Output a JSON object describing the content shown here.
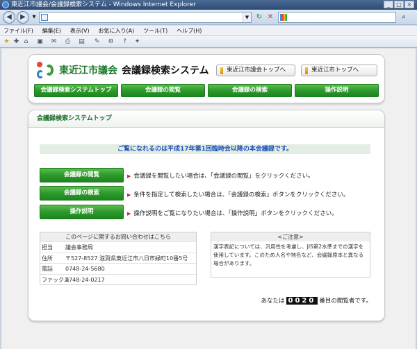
{
  "window": {
    "title": "東近江市議会/会議録検索システム - Windows Internet Explorer"
  },
  "browser": {
    "address_prefix": "e",
    "menu": [
      "ファイル(F)",
      "編集(E)",
      "表示(V)",
      "お気に入り(A)",
      "ツール(T)",
      "ヘルプ(H)"
    ]
  },
  "header": {
    "org_name": "東近江市議会",
    "system_name": "会議録検索システム",
    "link_council": "東近江市議会トップへ",
    "link_city": "東近江市トップへ",
    "tabs": [
      "会議録検索システムトップ",
      "会議録の閲覧",
      "会議録の検索",
      "操作説明"
    ]
  },
  "main": {
    "title": "会議録検索システムトップ",
    "notice": "ご覧になれるのは平成17年第1回臨時会以降の本会議録です。",
    "features": [
      {
        "label": "会議録の閲覧",
        "desc": "会議録を閲覧したい場合は、「会議録の閲覧」をクリックください。"
      },
      {
        "label": "会議録の検索",
        "desc": "条件を指定して検索したい場合は、「会議録の検索」ボタンをクリックください。"
      },
      {
        "label": "操作説明",
        "desc": "操作説明をご覧になりたい場合は、「操作説明」ボタンをクリックください。"
      }
    ],
    "contact": {
      "title": "このページに関するお問い合わせはこちら",
      "rows": [
        {
          "k": "担当",
          "v": "議会事務局"
        },
        {
          "k": "住所",
          "v": "〒527-8527 滋賀県東近江市八日市緑町10番5号"
        },
        {
          "k": "電話",
          "v": "0748-24-5680"
        },
        {
          "k": "ファックス",
          "v": "0748-24-0217"
        }
      ]
    },
    "caution": {
      "title": "<ご注意>",
      "body": "漢字表記については、汎用性を考慮し、JIS第2水準までの漢字を使用しています。このため人名や地名など、会議録原本と異なる場合があります。"
    },
    "counter": {
      "prefix": "あなたは",
      "digits": "0020",
      "suffix": "番目の閲覧者です。"
    }
  }
}
